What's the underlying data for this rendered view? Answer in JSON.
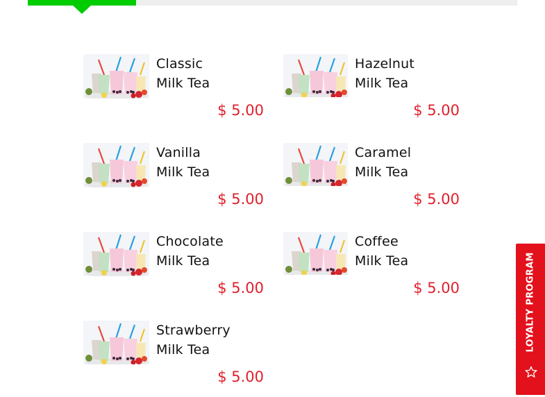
{
  "colors": {
    "accent": "#00cc00",
    "price": "#e0202c",
    "loyalty_bg": "#e3111c",
    "loyalty_fg": "#ffffff"
  },
  "tabs": {
    "active_icon": "tab-indicator"
  },
  "menu": {
    "items": [
      {
        "name_line1": "Classic",
        "name_line2": "Milk Tea",
        "price": "$ 5.00",
        "image_icon": "bubble-tea-photo"
      },
      {
        "name_line1": "Hazelnut",
        "name_line2": "Milk Tea",
        "price": "$ 5.00",
        "image_icon": "bubble-tea-photo"
      },
      {
        "name_line1": "Vanilla",
        "name_line2": "Milk Tea",
        "price": "$ 5.00",
        "image_icon": "bubble-tea-photo"
      },
      {
        "name_line1": "Caramel",
        "name_line2": "Milk Tea",
        "price": "$ 5.00",
        "image_icon": "bubble-tea-photo"
      },
      {
        "name_line1": "Chocolate",
        "name_line2": "Milk Tea",
        "price": "$ 5.00",
        "image_icon": "bubble-tea-photo"
      },
      {
        "name_line1": "Coffee",
        "name_line2": "Milk Tea",
        "price": "$ 5.00",
        "image_icon": "bubble-tea-photo"
      },
      {
        "name_line1": "Strawberry",
        "name_line2": "Milk Tea",
        "price": "$ 5.00",
        "image_icon": "bubble-tea-photo"
      }
    ]
  },
  "loyalty": {
    "label": "LOYALTY PROGRAM",
    "icon": "star-icon"
  }
}
